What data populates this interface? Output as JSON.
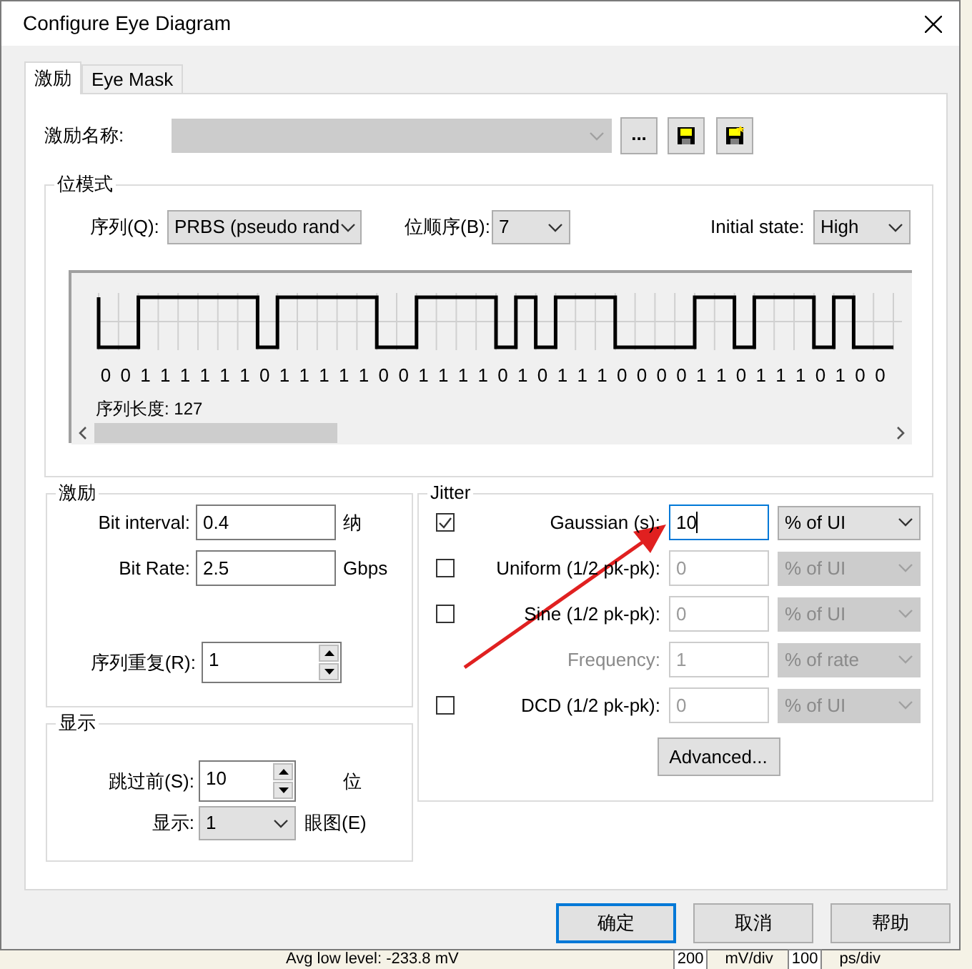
{
  "window": {
    "title": "Configure Eye Diagram"
  },
  "tabs": [
    {
      "label": "激励",
      "selected": true
    },
    {
      "label": "Eye Mask",
      "selected": false
    }
  ],
  "stimulus_name": {
    "label": "激励名称:",
    "disabled": true,
    "browse": "..."
  },
  "bit_pattern": {
    "title": "位模式",
    "sequence": {
      "label": "序列(Q):",
      "value": "PRBS (pseudo rand"
    },
    "bit_order": {
      "label": "位顺序(B):",
      "value": "7"
    },
    "initial_state": {
      "label": "Initial state:",
      "value": "High"
    },
    "bits": [
      "0",
      "0",
      "1",
      "1",
      "1",
      "1",
      "1",
      "1",
      "0",
      "1",
      "1",
      "1",
      "1",
      "1",
      "0",
      "0",
      "1",
      "1",
      "1",
      "1",
      "0",
      "1",
      "0",
      "1",
      "1",
      "1",
      "0",
      "0",
      "0",
      "0",
      "1",
      "1",
      "0",
      "1",
      "1",
      "1",
      "0",
      "1",
      "0",
      "0"
    ],
    "length": "序列长度: 127"
  },
  "stimulus": {
    "title": "激励",
    "fields": [
      {
        "label": "Bit interval:",
        "value": "0.4",
        "unit": "纳"
      },
      {
        "label": "Bit Rate:",
        "value": "2.5",
        "unit": "Gbps"
      }
    ],
    "repeat": {
      "label": "序列重复(R):",
      "value": "1"
    }
  },
  "display": {
    "title": "显示",
    "skip": {
      "label": "跳过前(S):",
      "value": "10",
      "unit": "位"
    },
    "show": {
      "label": "显示:",
      "value": "1",
      "unit": "眼图(E)"
    }
  },
  "jitter": {
    "title": "Jitter",
    "rows": [
      {
        "kind": "check",
        "checked": true,
        "label": "Gaussian (s):",
        "value": "10",
        "unit": "% of UI",
        "focused": true
      },
      {
        "kind": "check",
        "checked": false,
        "label": "Uniform (1/2 pk-pk):",
        "value": "0",
        "unit": "% of UI",
        "focused": false
      },
      {
        "kind": "check",
        "checked": false,
        "label": "Sine (1/2 pk-pk):",
        "value": "0",
        "unit": "% of UI",
        "focused": false
      },
      {
        "kind": "plain",
        "label": "Frequency:",
        "value": "1",
        "unit": "% of rate",
        "focused": false
      },
      {
        "kind": "check",
        "checked": false,
        "label": "DCD (1/2 pk-pk):",
        "value": "0",
        "unit": "% of UI",
        "focused": false
      }
    ],
    "advanced": "Advanced..."
  },
  "buttons": [
    {
      "label": "确定",
      "default": true
    },
    {
      "label": "取消",
      "default": false
    },
    {
      "label": "帮助",
      "default": false
    }
  ],
  "behind": {
    "level": "Avg low level: -233.8 mV",
    "volts": "200",
    "volts_unit": "mV/div",
    "time": "100",
    "time_unit": "ps/div"
  }
}
